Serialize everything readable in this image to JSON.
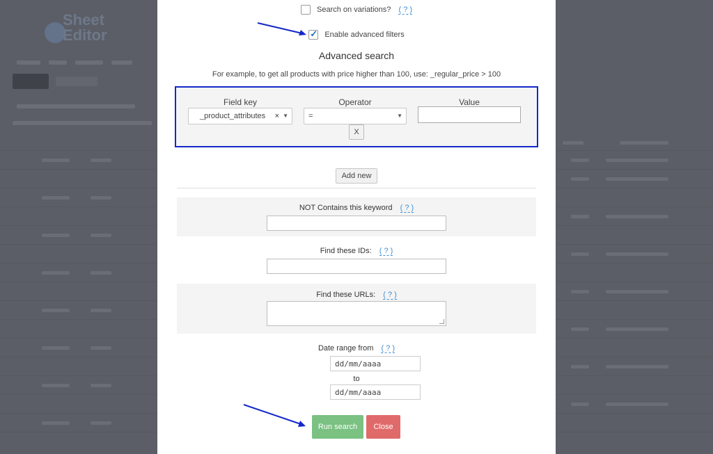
{
  "modal": {
    "search_variations": {
      "label": "Search on variations?",
      "help": "( ? )",
      "checked": false
    },
    "enable_advanced": {
      "label": "Enable advanced filters",
      "checked": true
    },
    "advanced_title": "Advanced search",
    "advanced_example": "For example, to get all products with price higher than 100, use: _regular_price > 100",
    "filter": {
      "field_key_label": "Field key",
      "operator_label": "Operator",
      "value_label": "Value",
      "field_key_value": "_product_attributes",
      "field_key_clear": "×",
      "operator_value": "=",
      "value": "",
      "remove_label": "X"
    },
    "add_new_label": "Add new",
    "not_contains": {
      "label": "NOT Contains this keyword",
      "help": "( ? )",
      "value": ""
    },
    "find_ids": {
      "label": "Find these IDs:",
      "help": "( ? )",
      "value": ""
    },
    "find_urls": {
      "label": "Find these URLs:",
      "help": "( ? )",
      "value": ""
    },
    "date_range": {
      "label": "Date range from",
      "help": "( ? )",
      "from_placeholder": "dd/mm/aaaa",
      "to_label": "to",
      "to_placeholder": "dd/mm/aaaa"
    },
    "run_search_label": "Run search",
    "close_label": "Close"
  },
  "colors": {
    "accent_border": "#1428c8",
    "run_button": "#7ac182",
    "close_button": "#e06a6a",
    "help_link": "#3d8fd6",
    "arrow": "#1428c8"
  },
  "background_app": {
    "logo_text": "Sheet Editor"
  }
}
